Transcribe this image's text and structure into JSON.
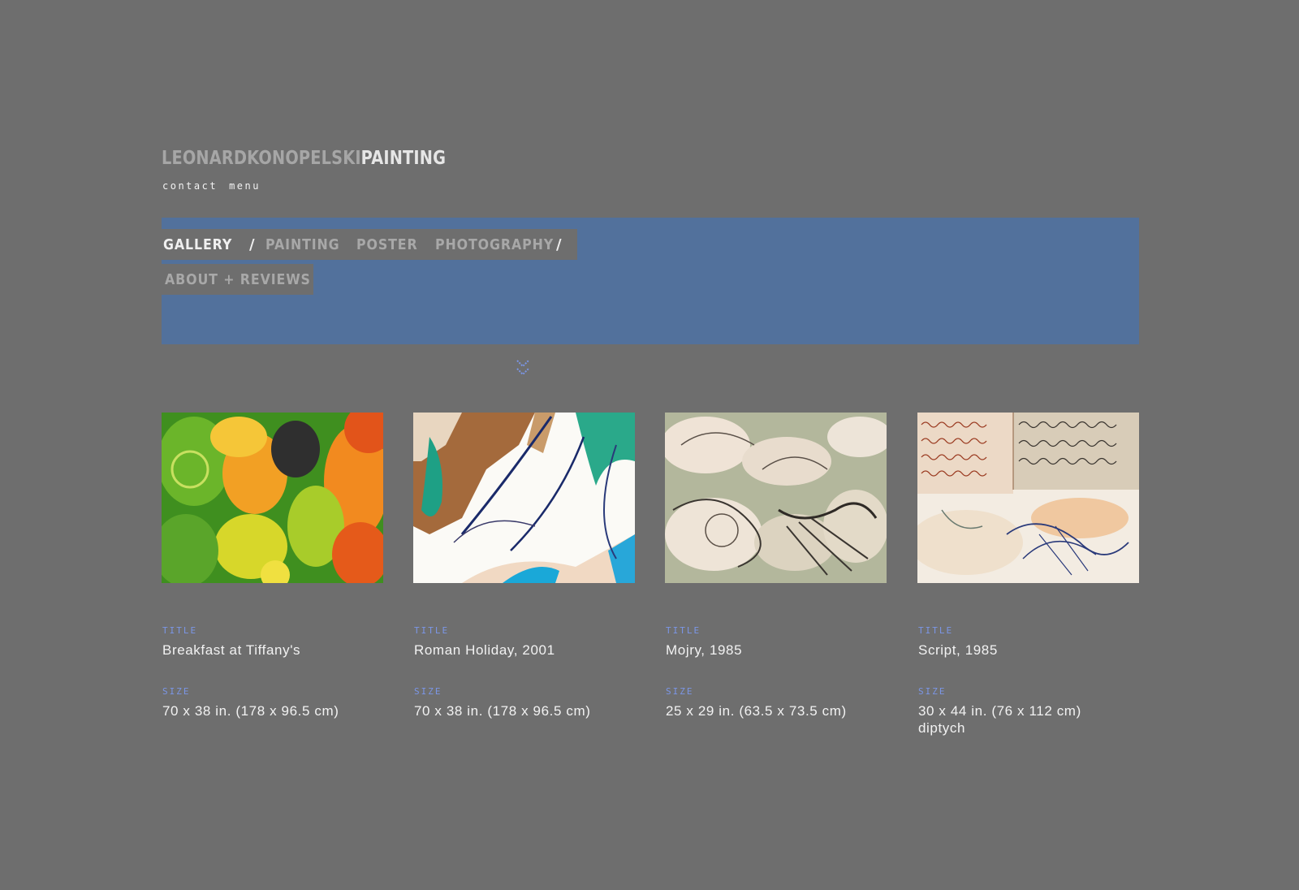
{
  "site": {
    "name": "LEONARDKONOPELSKI",
    "section": "PAINTING"
  },
  "top_links": {
    "contact": "contact",
    "menu": "menu"
  },
  "nav": {
    "gallery": "GALLERY",
    "sep": "/",
    "painting": "PAINTING",
    "poster": "POSTER",
    "photography": "PHOTOGRAPHY",
    "about": "ABOUT + REVIEWS"
  },
  "colors": {
    "background": "#6e6e6e",
    "nav_band": "#52719c",
    "label_accent": "#7b96e6",
    "text": "#f2f2f2"
  },
  "scroll_indicator": {
    "icon": "double-chevron-down-icon"
  },
  "gallery": {
    "items": [
      {
        "title_label": "TITLE",
        "title": "Breakfast at Tiffany's",
        "size_label": "SIZE",
        "size": "70 x 38 in. (178 x 96.5 cm)"
      },
      {
        "title_label": "TITLE",
        "title": "Roman Holiday, 2001",
        "size_label": "SIZE",
        "size": "70 x 38 in. (178 x 96.5 cm)"
      },
      {
        "title_label": "TITLE",
        "title": "Mojry, 1985",
        "size_label": "SIZE",
        "size": "25 x 29 in. (63.5 x 73.5 cm)"
      },
      {
        "title_label": "TITLE",
        "title": "Script, 1985",
        "size_label": "SIZE",
        "size": "30 x 44 in. (76 x 112 cm)\ndiptych"
      }
    ]
  }
}
